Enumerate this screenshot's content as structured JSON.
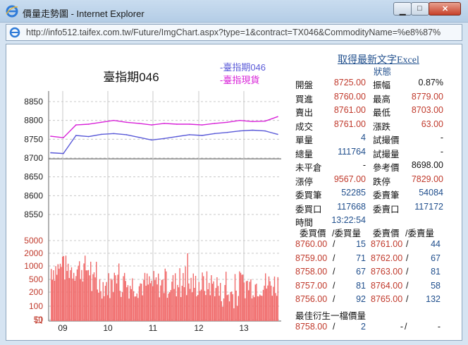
{
  "window": {
    "title": "價量走勢圖 - Internet Explorer",
    "url": "http://info512.taifex.com.tw/Future/ImgChart.aspx?type=1&contract=TX046&CommodityName=%e8%87%"
  },
  "chart": {
    "title": "臺指期046",
    "legend": [
      "-臺指期046",
      "-臺指現貨"
    ],
    "price_ticks": [
      "8850",
      "8800",
      "8750",
      "8700",
      "8650",
      "8600",
      "8550"
    ],
    "volume_ticks": [
      "5000",
      "2000",
      "1000",
      "500",
      "200",
      "100",
      "50",
      "口"
    ],
    "time_ticks": [
      "09",
      "10",
      "11",
      "12",
      "13"
    ]
  },
  "chart_data": {
    "type": "line",
    "title": "臺指期046",
    "x": [
      "09",
      "10",
      "11",
      "12",
      "13"
    ],
    "ylim": [
      8520,
      8880
    ],
    "series": [
      {
        "name": "臺指期046",
        "color": "#5a5ad8",
        "values": [
          8714,
          8712,
          8760,
          8757,
          8763,
          8765,
          8762,
          8755,
          8748,
          8752,
          8757,
          8762,
          8760,
          8765,
          8768,
          8772,
          8774,
          8772,
          8763
        ]
      },
      {
        "name": "臺指現貨",
        "color": "#d822d8",
        "values": [
          8758,
          8754,
          8788,
          8790,
          8795,
          8800,
          8795,
          8792,
          8788,
          8792,
          8790,
          8790,
          8788,
          8792,
          8795,
          8800,
          8797,
          8798,
          8810
        ]
      }
    ],
    "reference_line": 8698,
    "volume_ticks": [
      5000,
      2000,
      1000,
      500,
      200,
      100,
      50
    ],
    "grid": true
  },
  "panel": {
    "excel_link": "取得最新文字Excel",
    "status_label": "狀態",
    "rows": [
      {
        "l1": "開盤",
        "v1": "8725.00",
        "l2": "振幅",
        "v2": "0.87%"
      },
      {
        "l1": "買進",
        "v1": "8760.00",
        "l2": "最高",
        "v2": "8779.00"
      },
      {
        "l1": "賣出",
        "v1": "8761.00",
        "l2": "最低",
        "v2": "8703.00"
      },
      {
        "l1": "成交",
        "v1": "8761.00",
        "l2": "漲跌",
        "v2": "63.00"
      },
      {
        "l1": "單量",
        "v1": "4",
        "l2": "試撮價",
        "v2": "-"
      },
      {
        "l1": "總量",
        "v1": "111764",
        "l2": "試撮量",
        "v2": "-"
      },
      {
        "l1": "未平倉",
        "v1": "-",
        "l2": "參考價",
        "v2": "8698.00"
      },
      {
        "l1": "漲停",
        "v1": "9567.00",
        "l2": "跌停",
        "v2": "7829.00"
      },
      {
        "l1": "委買筆",
        "v1": "52285",
        "l2": "委賣筆",
        "v2": "54084"
      },
      {
        "l1": "委買口",
        "v1": "117668",
        "l2": "委賣口",
        "v2": "117172"
      },
      {
        "l1": "時間",
        "v1": "13:22:54",
        "l2": "",
        "v2": ""
      }
    ],
    "book_header": [
      "委買價",
      "/委買量",
      "委賣價",
      "/委賣量"
    ],
    "book": [
      {
        "bp": "8760.00",
        "bq": "15",
        "sp": "8761.00",
        "sq": "44"
      },
      {
        "bp": "8759.00",
        "bq": "71",
        "sp": "8762.00",
        "sq": "67"
      },
      {
        "bp": "8758.00",
        "bq": "67",
        "sp": "8763.00",
        "sq": "81"
      },
      {
        "bp": "8757.00",
        "bq": "81",
        "sp": "8764.00",
        "sq": "58"
      },
      {
        "bp": "8756.00",
        "bq": "92",
        "sp": "8765.00",
        "sq": "132"
      }
    ],
    "best_label": "最佳衍生一檔價量",
    "best": {
      "bp": "8758.00",
      "bq": "2",
      "sp": "-",
      "sq": "-"
    },
    "slash": "/"
  },
  "colors": {
    "up": "#c0392b",
    "label_blue": "#1f4e8c",
    "limit_up": "#d93a3a",
    "limit_down": "#1e8b2a"
  }
}
